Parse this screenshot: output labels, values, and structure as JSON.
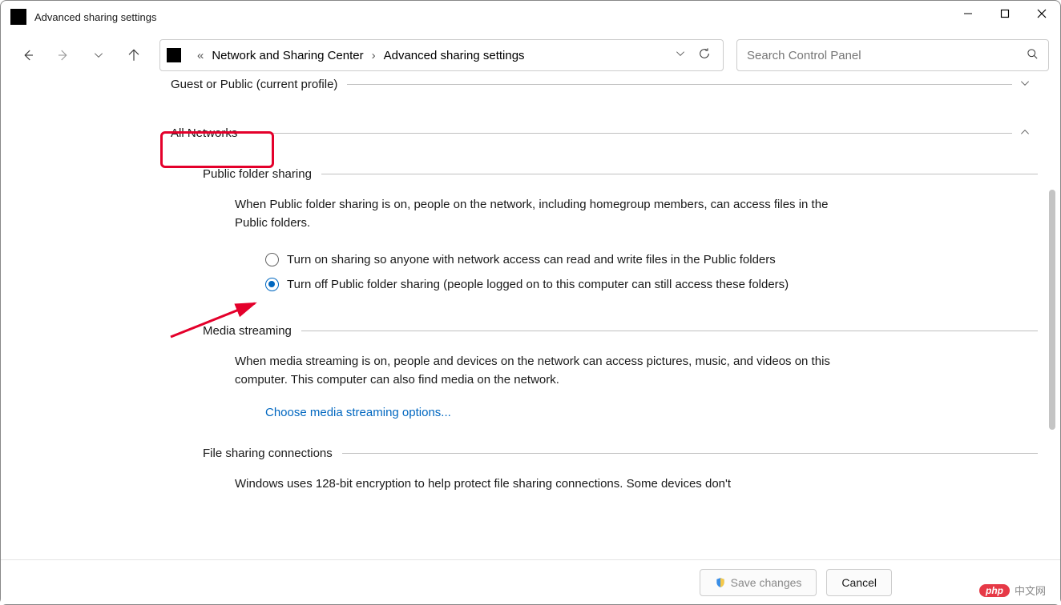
{
  "window": {
    "title": "Advanced sharing settings"
  },
  "breadcrumb": {
    "item1": "Network and Sharing Center",
    "item2": "Advanced sharing settings"
  },
  "search": {
    "placeholder": "Search Control Panel"
  },
  "sections": {
    "guest_public": {
      "label": "Guest or Public (current profile)"
    },
    "all_networks": {
      "label": "All Networks",
      "public_folder_sharing": {
        "heading": "Public folder sharing",
        "description": "When Public folder sharing is on, people on the network, including homegroup members, can access files in the Public folders.",
        "options": {
          "on": "Turn on sharing so anyone with network access can read and write files in the Public folders",
          "off": "Turn off Public folder sharing (people logged on to this computer can still access these folders)"
        },
        "selected": "off"
      },
      "media_streaming": {
        "heading": "Media streaming",
        "description": "When media streaming is on, people and devices on the network can access pictures, music, and videos on this computer. This computer can also find media on the network.",
        "link": "Choose media streaming options..."
      },
      "file_sharing_connections": {
        "heading": "File sharing connections",
        "description": "Windows uses 128-bit encryption to help protect file sharing connections. Some devices don't"
      }
    }
  },
  "buttons": {
    "save": "Save changes",
    "cancel": "Cancel"
  },
  "watermark": {
    "badge": "php",
    "text": "中文网"
  }
}
